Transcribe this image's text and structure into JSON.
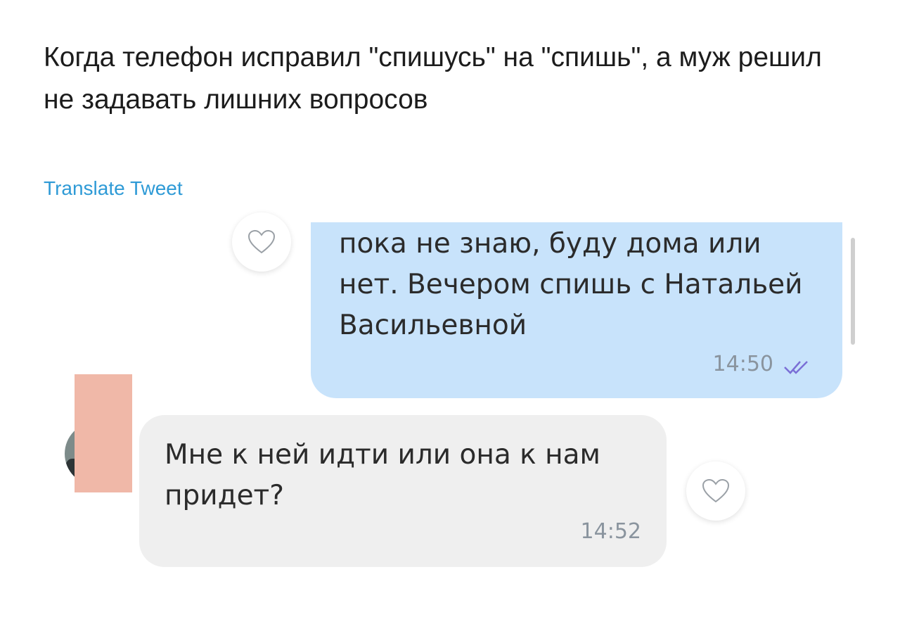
{
  "tweet": {
    "text": "Когда телефон исправил \"спишусь\" на \"спишь\", а муж решил не задавать лишних вопросов",
    "translate_label": "Translate Tweet"
  },
  "chat": {
    "outgoing": {
      "text": "пока не знаю, буду дома или нет. Вечером спишь с Натальей Васильевной",
      "time": "14:50",
      "status_icon": "double-check-icon"
    },
    "incoming": {
      "text": "Мне к ней идти или она к нам придет?",
      "time": "14:52"
    }
  },
  "colors": {
    "outgoing_bubble": "#c8e3fb",
    "incoming_bubble": "#efefef",
    "link": "#2e9ad6",
    "read_check": "#7b6fd6"
  }
}
